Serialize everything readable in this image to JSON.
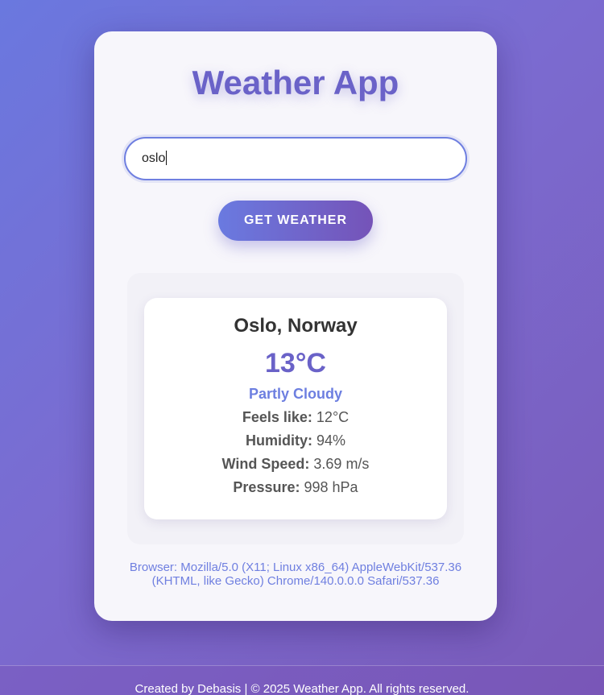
{
  "app": {
    "title": "Weather App"
  },
  "search": {
    "value": "oslo",
    "button_label": "GET WEATHER"
  },
  "weather": {
    "location": "Oslo, Norway",
    "temperature": "13°C",
    "condition": "Partly Cloudy",
    "feels_like_label": "Feels like:",
    "feels_like_value": "12°C",
    "humidity_label": "Humidity:",
    "humidity_value": "94%",
    "wind_label": "Wind Speed:",
    "wind_value": "3.69 m/s",
    "pressure_label": "Pressure:",
    "pressure_value": "998 hPa"
  },
  "browser_info": {
    "line1": "Browser: Mozilla/5.0 (X11; Linux x86_64) AppleWebKit/537.36",
    "line2": "(KHTML, like Gecko) Chrome/140.0.0.0 Safari/537.36"
  },
  "footer": {
    "text": "Created by Debasis | © 2025 Weather App. All rights reserved."
  },
  "colors": {
    "accent": "#6a62c8",
    "condition": "#6d7fe0",
    "background_start": "#6a78df",
    "background_end": "#7a5ab9"
  }
}
